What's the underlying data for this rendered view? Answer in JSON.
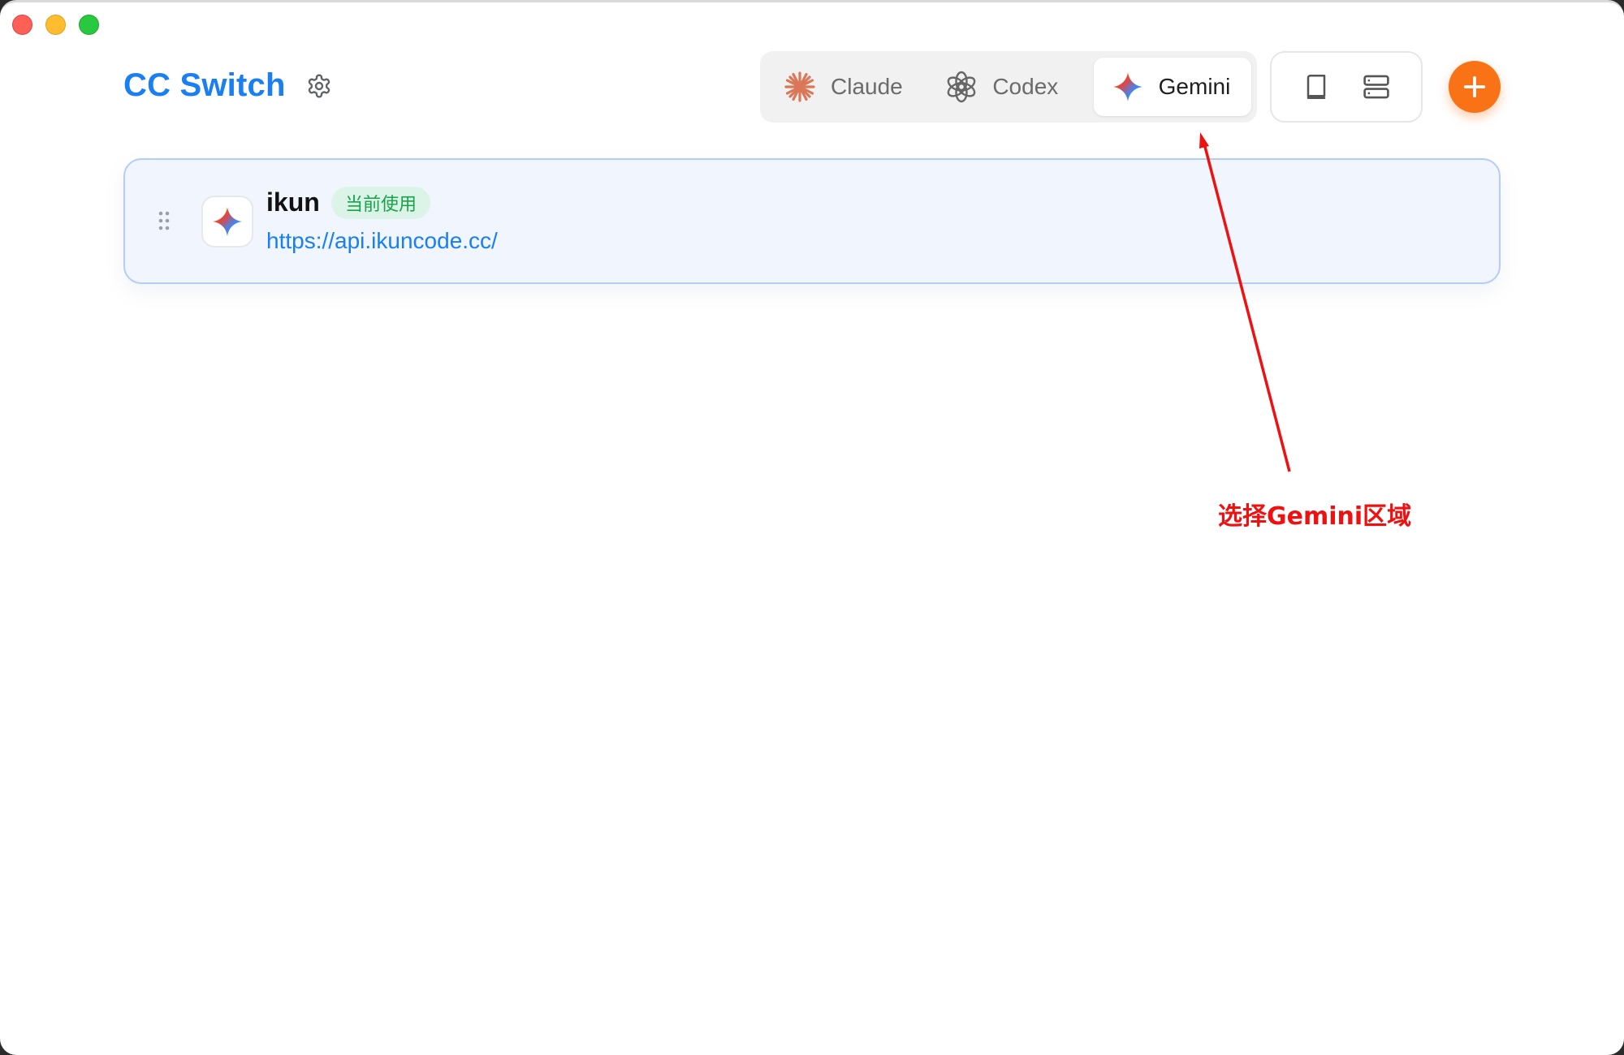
{
  "app": {
    "title": "CC Switch"
  },
  "switcher": {
    "tabs": [
      {
        "label": "Claude",
        "icon": "claude-icon",
        "selected": false
      },
      {
        "label": "Codex",
        "icon": "openai-icon",
        "selected": false
      },
      {
        "label": "Gemini",
        "icon": "gemini-icon",
        "selected": true
      }
    ]
  },
  "toolbar": {
    "tools": [
      {
        "icon": "book-icon"
      },
      {
        "icon": "server-icon"
      }
    ],
    "add_icon": "plus-icon"
  },
  "providers": [
    {
      "name": "ikun",
      "badge": "当前使用",
      "url": "https://api.ikuncode.cc/",
      "icon": "gemini-icon"
    }
  ],
  "annotation": {
    "text": "选择Gemini区域",
    "color": "#ee1111"
  },
  "colors": {
    "accent": "#1a7ff0",
    "add_button": "#f97316",
    "badge_text": "#16a34a",
    "badge_bg": "#dcf3e7",
    "card_bg": "#f0f5fe",
    "card_border": "#b3cdf5"
  }
}
